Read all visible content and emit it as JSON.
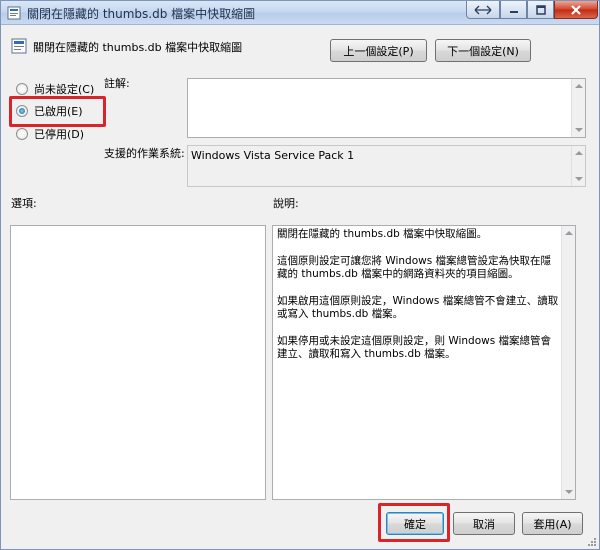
{
  "window": {
    "title": "關閉在隱藏的 thumbs.db 檔案中快取縮圖",
    "controls": [
      "restore-icon",
      "minimize-icon",
      "maximize-icon",
      "close-icon"
    ]
  },
  "header": {
    "policy_title": "關閉在隱藏的 thumbs.db 檔案中快取縮圖",
    "prev_button": "上一個設定(P)",
    "next_button": "下一個設定(N)"
  },
  "state": {
    "options": [
      {
        "label": "尚未設定(C)",
        "checked": false
      },
      {
        "label": "已啟用(E)",
        "checked": true
      },
      {
        "label": "已停用(D)",
        "checked": false
      }
    ]
  },
  "comment": {
    "label": "註解:",
    "value": ""
  },
  "supported": {
    "label": "支援的作業系統:",
    "value": "Windows Vista Service Pack 1"
  },
  "options_panel": {
    "label": "選項:"
  },
  "help_panel": {
    "label": "說明:",
    "paragraphs": [
      "關閉在隱藏的 thumbs.db 檔案中快取縮圖。",
      "這個原則設定可讓您將 Windows 檔案總管設定為快取在隱藏的 thumbs.db 檔案中的網路資料夾的項目縮圖。",
      "如果啟用這個原則設定，Windows 檔案總管不會建立、讀取或寫入 thumbs.db 檔案。",
      "如果停用或未設定這個原則設定，則 Windows 檔案總管會建立、讀取和寫入 thumbs.db 檔案。"
    ]
  },
  "footer": {
    "ok_button": "確定",
    "cancel_button": "取消",
    "apply_button": "套用(A)"
  },
  "colors": {
    "highlight": "#d9242a",
    "window_bg": "#f0f0f0"
  }
}
